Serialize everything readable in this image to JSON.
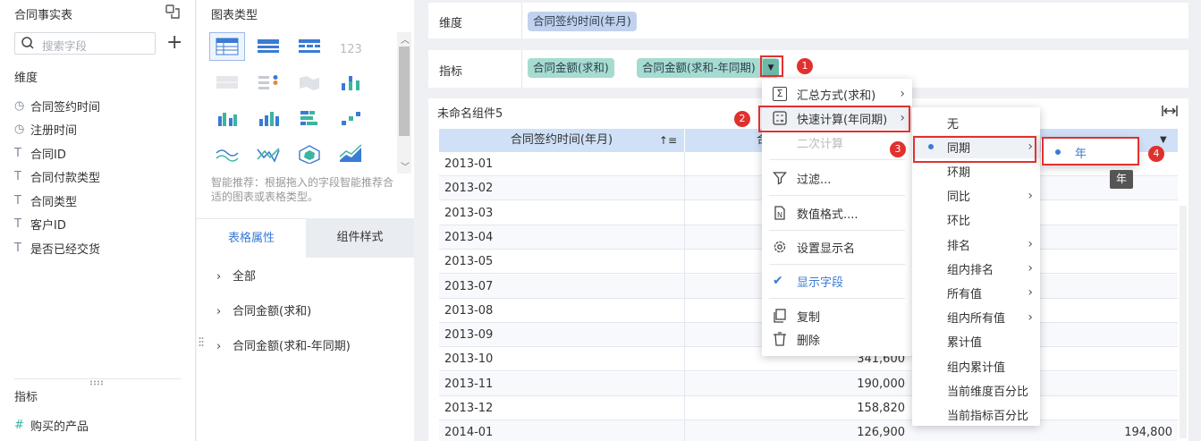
{
  "left_panel": {
    "title": "合同事实表",
    "search_placeholder": "搜索字段",
    "dimension_label": "维度",
    "dimension_fields": [
      {
        "label": "合同签约时间",
        "icon": "clock-icon",
        "glyph": "◷"
      },
      {
        "label": "注册时间",
        "icon": "clock-icon",
        "glyph": "◷"
      },
      {
        "label": "合同ID",
        "icon": "text-type-icon",
        "glyph": "T"
      },
      {
        "label": "合同付款类型",
        "icon": "text-type-icon",
        "glyph": "T"
      },
      {
        "label": "合同类型",
        "icon": "text-type-icon",
        "glyph": "T"
      },
      {
        "label": "客户ID",
        "icon": "text-type-icon",
        "glyph": "T"
      },
      {
        "label": "是否已经交货",
        "icon": "text-type-icon",
        "glyph": "T"
      }
    ],
    "measure_label": "指标",
    "measure_fields": [
      {
        "label": "购买的产品",
        "icon": "number-type-icon",
        "glyph": "#"
      }
    ]
  },
  "chart_panel": {
    "title": "图表类型",
    "hint": "智能推荐：根据拖入的字段智能推荐合适的图表或表格类型。",
    "tabs": [
      "表格属性",
      "组件样式"
    ],
    "groups": [
      "全部",
      "合同金额(求和)",
      "合同金额(求和-年同期)"
    ]
  },
  "config": {
    "dimension_label": "维度",
    "dimension_chip": "合同签约时间(年月)",
    "measure_label": "指标",
    "measure_chips": [
      "合同金额(求和)",
      "合同金额(求和-年同期)"
    ]
  },
  "component": {
    "title": "未命名组件5",
    "table_header": [
      "合同签约时间(年月)",
      "合",
      ""
    ],
    "rows": [
      [
        "2013-01",
        "",
        ""
      ],
      [
        "2013-02",
        "",
        ""
      ],
      [
        "2013-03",
        "",
        ""
      ],
      [
        "2013-04",
        "",
        ""
      ],
      [
        "2013-05",
        "",
        ""
      ],
      [
        "2013-07",
        "",
        ""
      ],
      [
        "2013-08",
        "",
        ""
      ],
      [
        "2013-09",
        "",
        ""
      ],
      [
        "2013-10",
        "341,600",
        ""
      ],
      [
        "2013-11",
        "190,000",
        ""
      ],
      [
        "2013-12",
        "158,820",
        ""
      ],
      [
        "2014-01",
        "126,900",
        "194,800"
      ]
    ]
  },
  "menu1": {
    "items": [
      "汇总方式(求和)",
      "快速计算(年同期)",
      "二次计算",
      "过滤...",
      "数值格式....",
      "设置显示名",
      "显示字段",
      "复制",
      "删除"
    ]
  },
  "menu2": {
    "items": [
      "无",
      "同期",
      "环期",
      "同比",
      "环比",
      "排名",
      "组内排名",
      "所有值",
      "组内所有值",
      "累计值",
      "组内累计值",
      "当前维度百分比",
      "当前指标百分比"
    ]
  },
  "menu3": {
    "items": [
      "年"
    ]
  },
  "tooltip": "年",
  "badges": [
    "1",
    "2",
    "3",
    "4"
  ],
  "colors": {
    "accent": "#3a7bd5",
    "red": "#e0312f",
    "dim_chip": "#c2d2ee",
    "measure_chip": "#a6dccf"
  }
}
